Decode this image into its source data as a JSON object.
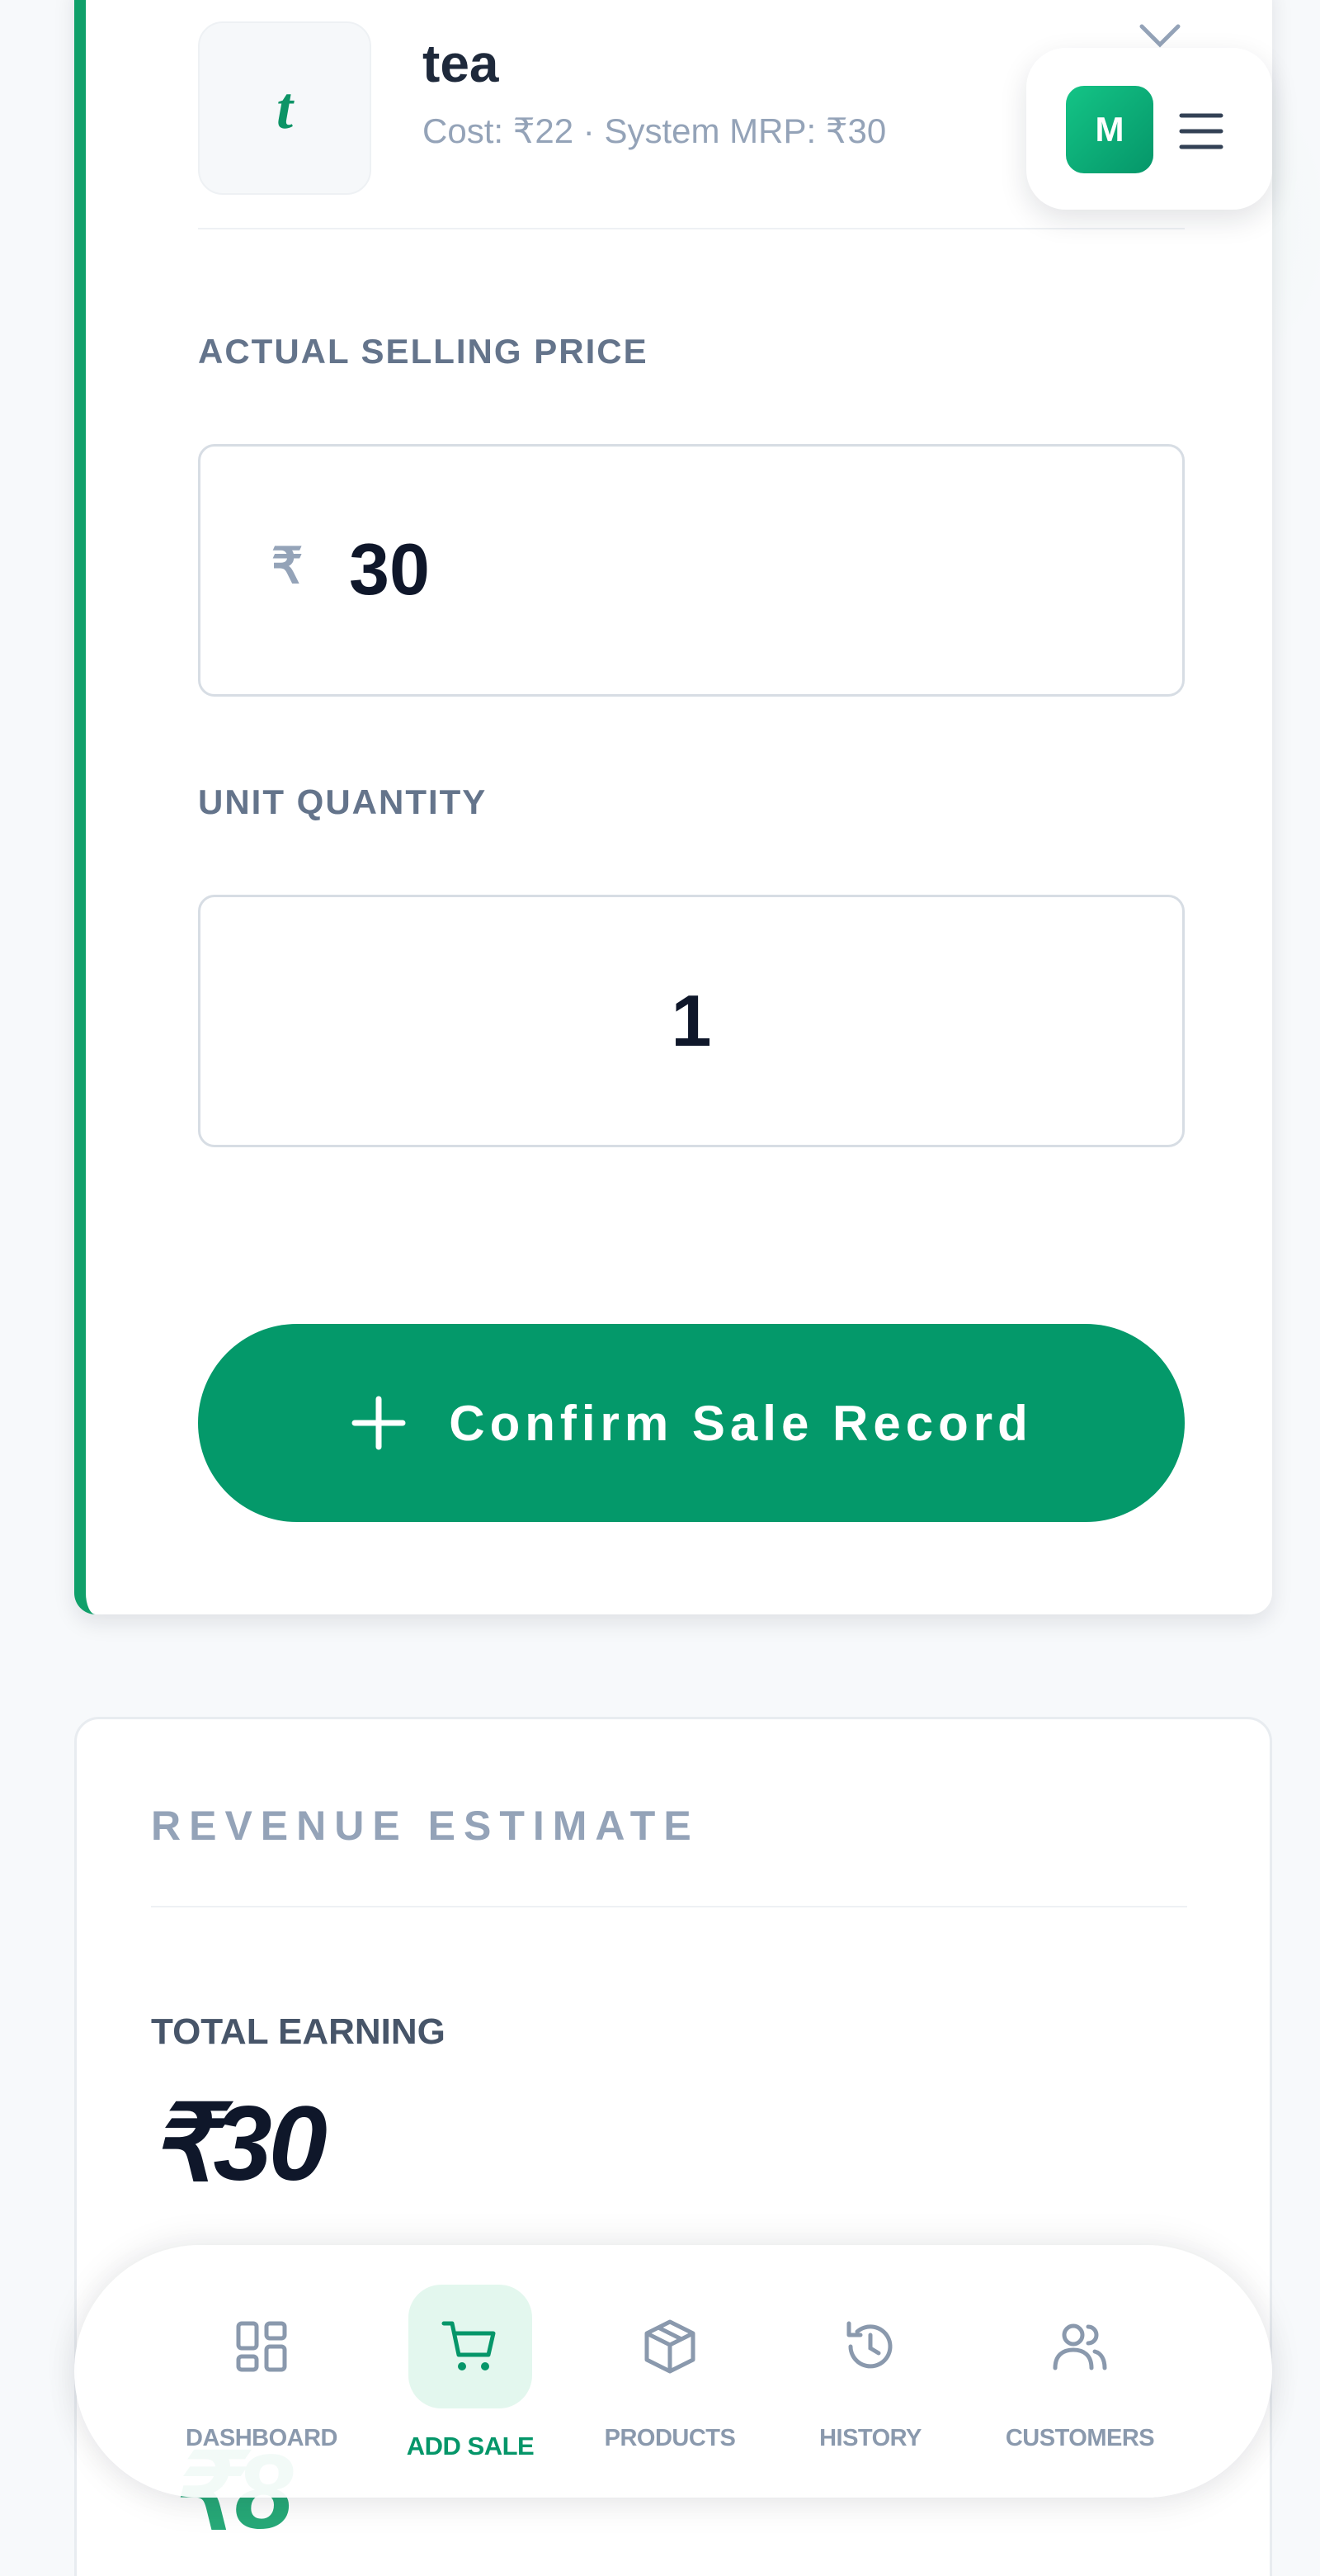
{
  "product": {
    "initial": "t",
    "name": "tea",
    "meta": "Cost: ₹22 · System MRP: ₹30"
  },
  "form": {
    "price_label": "ACTUAL SELLING PRICE",
    "currency_symbol": "₹",
    "price_value": "30",
    "quantity_label": "UNIT QUANTITY",
    "quantity_value": "1",
    "confirm_label": "Confirm Sale Record"
  },
  "user": {
    "initial": "M"
  },
  "revenue": {
    "title": "REVENUE ESTIMATE",
    "total_label": "TOTAL EARNING",
    "total_value": "₹30",
    "margin_value_partial": "₹8"
  },
  "nav": {
    "items": [
      {
        "label": "DASHBOARD",
        "icon": "dashboard-icon",
        "active": false
      },
      {
        "label": "ADD SALE",
        "icon": "cart-icon",
        "active": true
      },
      {
        "label": "PRODUCTS",
        "icon": "box-icon",
        "active": false
      },
      {
        "label": "HISTORY",
        "icon": "history-icon",
        "active": false
      },
      {
        "label": "CUSTOMERS",
        "icon": "users-icon",
        "active": false
      }
    ]
  },
  "colors": {
    "accent": "#04996a",
    "accent_light": "#e3f7ee",
    "text_dark": "#0f172a",
    "muted": "#94a3b8"
  }
}
